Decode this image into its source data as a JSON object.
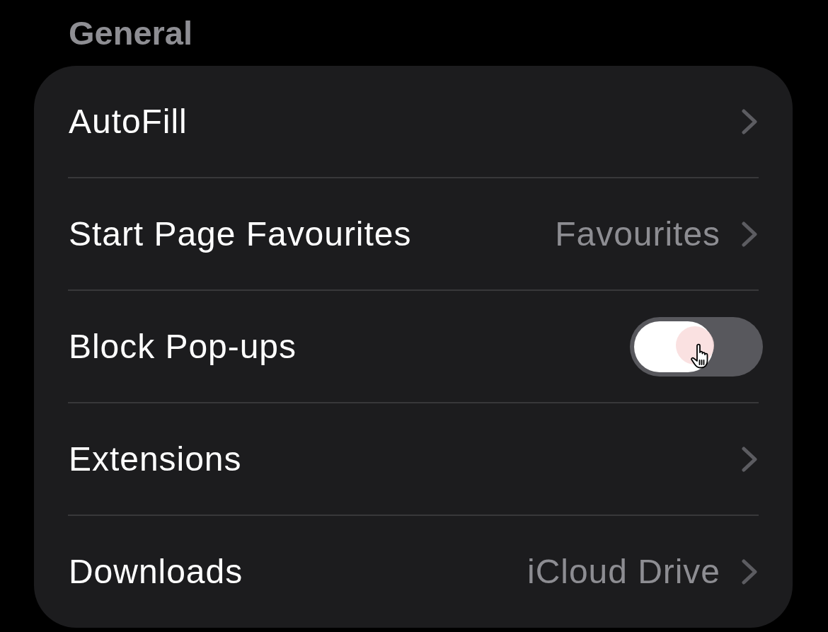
{
  "section": {
    "title": "General"
  },
  "rows": [
    {
      "kind": "link",
      "label": "AutoFill"
    },
    {
      "kind": "link",
      "label": "Start Page Favourites",
      "value": "Favourites"
    },
    {
      "kind": "toggle",
      "label": "Block Pop-ups",
      "on": false,
      "pressed": true
    },
    {
      "kind": "link",
      "label": "Extensions"
    },
    {
      "kind": "link",
      "label": "Downloads",
      "value": "iCloud Drive"
    }
  ]
}
